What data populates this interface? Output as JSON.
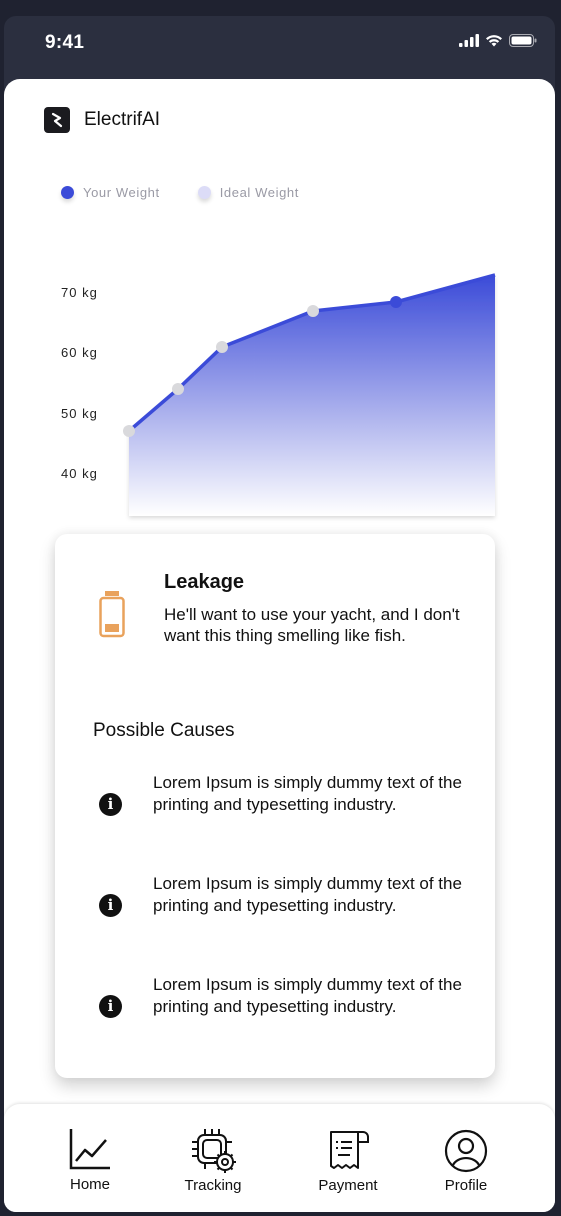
{
  "status_bar": {
    "time": "9:41"
  },
  "app": {
    "name": "ElectrifAI"
  },
  "legend": [
    {
      "label": "Your Weight",
      "color": "#3b4bd8"
    },
    {
      "label": "Ideal Weight",
      "color": "#dcdcf7"
    }
  ],
  "chart_data": {
    "type": "area",
    "y_ticks": [
      "70 kg",
      "60 kg",
      "50 kg",
      "40 kg"
    ],
    "ylim": [
      40,
      70
    ],
    "series": [
      {
        "name": "Your Weight",
        "values": [
          47,
          54,
          61,
          67,
          68.5,
          73
        ]
      }
    ],
    "accent": "#3b4bd8"
  },
  "issue": {
    "title": "Leakage",
    "description": "He'll want to use your yacht, and I don't want this thing smelling like fish.",
    "icon": "battery-low-icon",
    "icon_color": "#e9a25c"
  },
  "causes": {
    "title": "Possible Causes",
    "items": [
      {
        "text": "Lorem Ipsum is simply dummy text of the printing and typesetting industry."
      },
      {
        "text": "Lorem Ipsum is simply dummy text of the printing and typesetting industry."
      },
      {
        "text": "Lorem Ipsum is simply dummy text of the printing and typesetting industry."
      }
    ]
  },
  "tabs": [
    {
      "label": "Home",
      "icon": "chart-line-icon"
    },
    {
      "label": "Tracking",
      "icon": "chip-gear-icon"
    },
    {
      "label": "Payment",
      "icon": "receipt-icon"
    },
    {
      "label": "Profile",
      "icon": "user-circle-icon"
    }
  ]
}
